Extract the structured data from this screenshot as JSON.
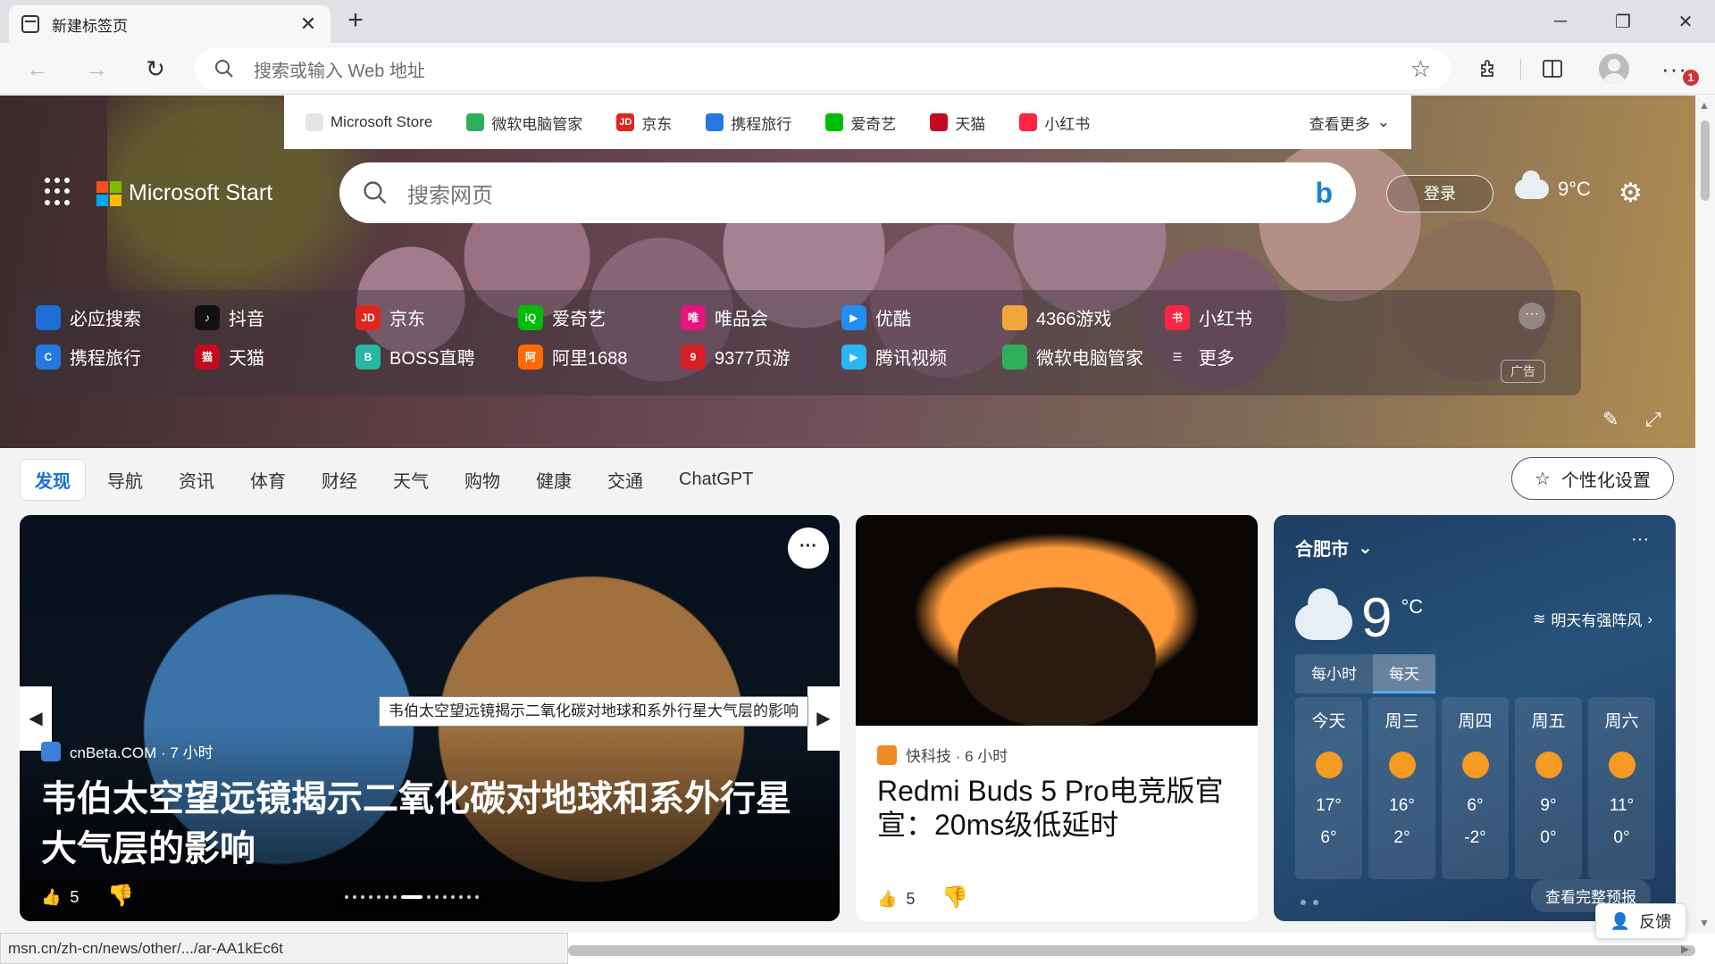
{
  "tab": {
    "title": "新建标签页",
    "close": "✕",
    "new_tab": "+"
  },
  "window": {
    "minimize": "─",
    "restore": "❐",
    "close": "✕"
  },
  "toolbar": {
    "back": "←",
    "forward": "→",
    "refresh": "↻",
    "address_placeholder": "搜索或输入 Web 地址",
    "more": "···",
    "notification_count": "1"
  },
  "quicklinks": {
    "items": [
      {
        "label": "Microsoft Store",
        "color": "#e5e5e5"
      },
      {
        "label": "微软电脑管家",
        "color": "#2fae5c"
      },
      {
        "label": "京东",
        "color": "#e1251b",
        "glyph": "JD"
      },
      {
        "label": "携程旅行",
        "color": "#2577e3"
      },
      {
        "label": "爱奇艺",
        "color": "#00be06"
      },
      {
        "label": "天猫",
        "color": "#c40a1e"
      },
      {
        "label": "小红书",
        "color": "#ff2442"
      }
    ],
    "more_label": "查看更多"
  },
  "header": {
    "brand": "Microsoft Start",
    "search_placeholder": "搜索网页",
    "login": "登录",
    "temperature": "9°C"
  },
  "sites": {
    "row1": [
      {
        "label": "必应搜索",
        "color": "#1b6ed6",
        "glyph": ""
      },
      {
        "label": "抖音",
        "color": "#111111",
        "glyph": "♪"
      },
      {
        "label": "京东",
        "color": "#e1251b",
        "glyph": "JD"
      },
      {
        "label": "爱奇艺",
        "color": "#00be06",
        "glyph": "iQ"
      },
      {
        "label": "唯品会",
        "color": "#e8137f",
        "glyph": "唯"
      },
      {
        "label": "优酷",
        "color": "#1f8ff0",
        "glyph": "▶"
      },
      {
        "label": "4366游戏",
        "color": "#f1a63b",
        "glyph": ""
      },
      {
        "label": "小红书",
        "color": "#ff2442",
        "glyph": "书"
      }
    ],
    "row2": [
      {
        "label": "携程旅行",
        "color": "#2577e3",
        "glyph": "C"
      },
      {
        "label": "天猫",
        "color": "#c40a1e",
        "glyph": "猫"
      },
      {
        "label": "BOSS直聘",
        "color": "#26b8a5",
        "glyph": "B"
      },
      {
        "label": "阿里1688",
        "color": "#ff6a00",
        "glyph": "阿"
      },
      {
        "label": "9377页游",
        "color": "#d81f26",
        "glyph": "9"
      },
      {
        "label": "腾讯视频",
        "color": "#29b6f6",
        "glyph": "▶"
      },
      {
        "label": "微软电脑管家",
        "color": "#2fae5c",
        "glyph": ""
      },
      {
        "label": "更多",
        "color": "transparent",
        "glyph": "☰"
      }
    ],
    "ad_label": "广告"
  },
  "feed": {
    "tabs": [
      "发现",
      "导航",
      "资讯",
      "体育",
      "财经",
      "天气",
      "购物",
      "健康",
      "交通",
      "ChatGPT"
    ],
    "personalize": "个性化设置"
  },
  "main_card": {
    "tooltip": "韦伯太空望远镜揭示二氧化碳对地球和系外行星大气层的影响",
    "source": "cnBeta.COM · 7 小时",
    "title": "韦伯太空望远镜揭示二氧化碳对地球和系外行星大气层的影响",
    "likes": "5"
  },
  "card2": {
    "source": "快科技 · 6 小时",
    "title": "Redmi Buds 5 Pro电竞版官宣：20ms级低延时",
    "likes": "5"
  },
  "weather": {
    "city": "合肥市",
    "temp": "9",
    "unit": "°C",
    "alert": "明天有强阵风",
    "tabs": [
      "每小时",
      "每天"
    ],
    "days": [
      {
        "name": "今天",
        "hi": "17°",
        "lo": "6°"
      },
      {
        "name": "周三",
        "hi": "16°",
        "lo": "2°"
      },
      {
        "name": "周四",
        "hi": "6°",
        "lo": "-2°"
      },
      {
        "name": "周五",
        "hi": "9°",
        "lo": "0°"
      },
      {
        "name": "周六",
        "hi": "11°",
        "lo": "0°"
      }
    ],
    "forecast_link": "查看完整预报"
  },
  "feedback": "反馈",
  "status_url": "msn.cn/zh-cn/news/other/.../ar-AA1kEc6t"
}
